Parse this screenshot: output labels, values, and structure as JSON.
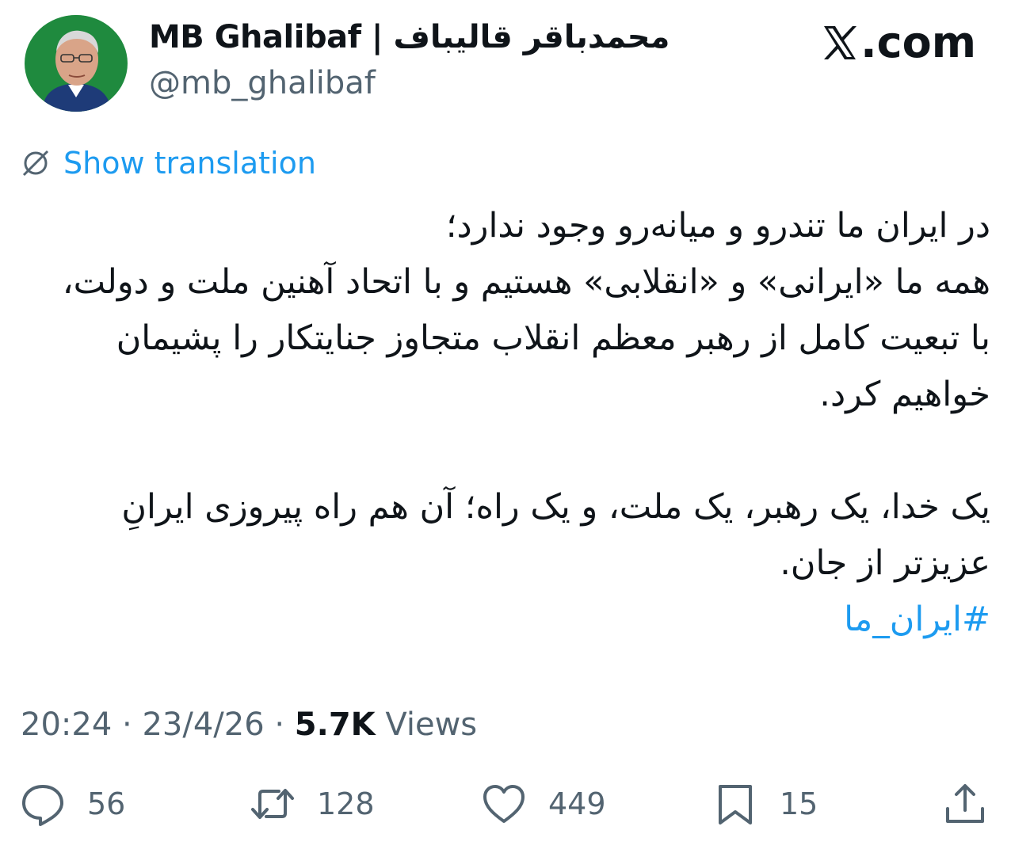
{
  "header": {
    "display_name": "MB Ghalibaf | محمدباقر قالیباف",
    "handle": "@mb_ghalibaf",
    "site_label": ".com",
    "avatar_bg": "#1f8a3e"
  },
  "translate": {
    "label": "Show translation",
    "icon": "globe-icon",
    "color": "#1d9bf0"
  },
  "tweet": {
    "paragraphs": [
      "در ایران ما تندرو و میانه‌رو وجود ندارد؛",
      "همه ما «ایرانی» و «انقلابی» هستیم و با اتحاد آهنین ملت و دولت، با تبعیت کامل از رهبر معظم انقلاب متجاوز جنایتکار را پشیمان خواهیم کرد.",
      "یک خدا، یک رهبر، یک ملت، و یک راه؛ آن هم راه پیروزی ایرانِ عزیزتر از جان."
    ],
    "hashtag": "#ایران_ما"
  },
  "meta": {
    "time": "20:24",
    "separator1": " · ",
    "date": "23/4/26",
    "separator2": " · ",
    "views_count": "5.7K",
    "views_label": " Views"
  },
  "actions": {
    "replies": "56",
    "reposts": "128",
    "likes": "449",
    "bookmarks": "15"
  },
  "colors": {
    "text": "#0f1419",
    "secondary": "#536471",
    "link": "#1d9bf0"
  }
}
